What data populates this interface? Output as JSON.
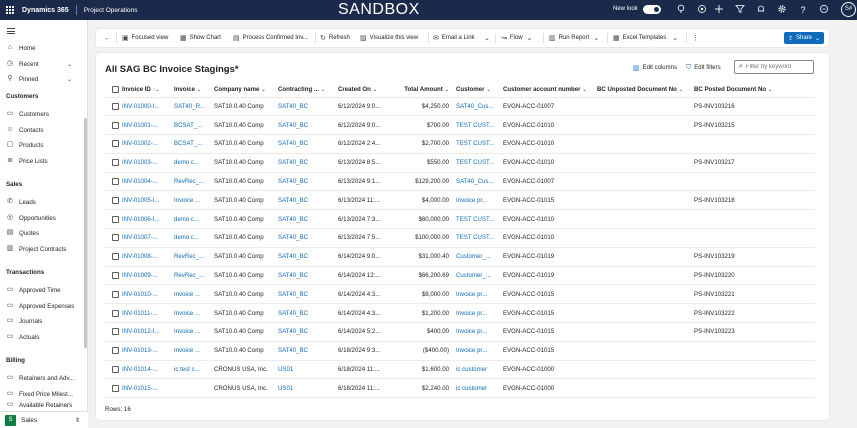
{
  "topbar": {
    "brand": "Dynamics 365",
    "app": "Project Operations",
    "environment": "SANDBOX",
    "new_look_label": "New look",
    "user_initials": "S#",
    "icons": [
      "lightbulb-icon",
      "target-icon",
      "plus-icon",
      "filter-icon",
      "bell-icon",
      "settings-icon",
      "help-icon",
      "copilot-icon"
    ]
  },
  "sidebar": {
    "top_items": [
      {
        "label": "Home",
        "icon": "home-icon"
      },
      {
        "label": "Recent",
        "icon": "clock-icon",
        "chevron": "⌄"
      },
      {
        "label": "Pinned",
        "icon": "pin-icon",
        "chevron": "⌄"
      }
    ],
    "groups": [
      {
        "title": "Customers",
        "items": [
          "Customers",
          "Contacts",
          "Products",
          "Price Lists"
        ]
      },
      {
        "title": "Sales",
        "items": [
          "Leads",
          "Opportunities",
          "Quotes",
          "Project Contracts"
        ]
      },
      {
        "title": "Transactions",
        "items": [
          "Approved Time",
          "Approved Expenses",
          "Journals",
          "Actuals"
        ]
      },
      {
        "title": "Billing",
        "items": [
          "Retainers and Adv...",
          "Fixed Price Milest...",
          "Available Retainers"
        ]
      }
    ],
    "area": {
      "badge": "S",
      "label": "Sales"
    }
  },
  "commands": {
    "focused_view": "Focused view",
    "show_chart": "Show Chart",
    "process_confirmed": "Process Confirmed Inv...",
    "refresh": "Refresh",
    "visualize": "Visualize this view",
    "email_link": "Email a Link",
    "flow": "Flow",
    "run_report": "Run Report",
    "excel_templates": "Excel Templates",
    "share": "Share"
  },
  "view": {
    "title": "All SAG BC Invoice Stagings*",
    "edit_columns": "Edit columns",
    "edit_filters": "Edit filters",
    "filter_placeholder": "Filter by keyword",
    "rows_label": "Rows: 16"
  },
  "columns": [
    "Invoice ID",
    "Invoice",
    "Company name",
    "Contracting ...",
    "Created On",
    "Total Amount",
    "Customer",
    "Customer account number",
    "BC Unposted Document No",
    "BC Posted Document No"
  ],
  "rows": [
    [
      "INV-01000-I...",
      "SAT40_R...",
      "SAT10.0.40 Comp",
      "SAT40_BC",
      "6/12/2024 9:0...",
      "$4,250.00",
      "SAT40_Cus...",
      "EVGN-ACC-01007",
      "",
      "PS-INV103216"
    ],
    [
      "INV-01001-...",
      "BCSAT_...",
      "SAT10.0.40 Comp",
      "SAT40_BC",
      "6/12/2024 9:0...",
      "$700.00",
      "TEST CUST...",
      "EVGN-ACC-01010",
      "",
      "PS-INV103215"
    ],
    [
      "INV-01002-...",
      "BCSAT_...",
      "SAT10.0.40 Comp",
      "SAT40_BC",
      "6/12/2024 2:4...",
      "$2,700.00",
      "TEST CUST...",
      "EVGN-ACC-01010",
      "",
      ""
    ],
    [
      "INV-01003-...",
      "demo c...",
      "SAT10.0.40 Comp",
      "SAT40_BC",
      "6/13/2024 8:5...",
      "$550.00",
      "TEST CUST...",
      "EVGN-ACC-01010",
      "",
      "PS-INV103217"
    ],
    [
      "INV-01004-...",
      "RevRec_...",
      "SAT10.0.40 Comp",
      "SAT40_BC",
      "6/13/2024 9:1...",
      "$129,200.00",
      "SAT40_Cus...",
      "EVGN-ACC-01007",
      "",
      ""
    ],
    [
      "INV-01005-I...",
      "Invoice ...",
      "SAT10.0.40 Comp",
      "SAT40_BC",
      "6/13/2024 11:...",
      "$4,000.00",
      "Invoice pr...",
      "EVGN-ACC-01015",
      "",
      "PS-INV103218"
    ],
    [
      "INV-01006-I...",
      "demo c...",
      "SAT10.0.40 Comp",
      "SAT40_BC",
      "6/13/2024 7:3...",
      "$60,000.00",
      "TEST CUST...",
      "EVGN-ACC-01010",
      "",
      ""
    ],
    [
      "INV-01007-...",
      "demo c...",
      "SAT10.0.40 Comp",
      "SAT40_BC",
      "6/13/2024 7:5...",
      "$100,000.00",
      "TEST CUST...",
      "EVGN-ACC-01010",
      "",
      ""
    ],
    [
      "INV-01008-...",
      "RevRec_...",
      "SAT10.0.40 Comp",
      "SAT40_BC",
      "6/14/2024 9:0...",
      "$31,000.40",
      "Customer_...",
      "EVGN-ACC-01019",
      "",
      "PS-INV103219"
    ],
    [
      "INV-01009-...",
      "RevRec_...",
      "SAT10.0.40 Comp",
      "SAT40_BC",
      "6/14/2024 12:...",
      "$66,200.69",
      "Customer_...",
      "EVGN-ACC-01019",
      "",
      "PS-INV103220"
    ],
    [
      "INV-01010-...",
      "Invoice ...",
      "SAT10.0.40 Comp",
      "SAT40_BC",
      "6/14/2024 4:3...",
      "$8,000.00",
      "Invoice pr...",
      "EVGN-ACC-01015",
      "",
      "PS-INV103221"
    ],
    [
      "INV-01011-...",
      "Invoice ...",
      "SAT10.0.40 Comp",
      "SAT40_BC",
      "6/14/2024 4:3...",
      "$1,200.00",
      "Invoice pr...",
      "EVGN-ACC-01015",
      "",
      "PS-INV103222"
    ],
    [
      "INV-01012-I...",
      "Invoice ...",
      "SAT10.0.40 Comp",
      "SAT40_BC",
      "6/14/2024 5:2...",
      "$400.00",
      "Invoice pr...",
      "EVGN-ACC-01015",
      "",
      "PS-INV103223"
    ],
    [
      "INV-01013-...",
      "Invoice ...",
      "SAT10.0.40 Comp",
      "SAT40_BC",
      "6/18/2024 9:3...",
      "($400.00)",
      "Invoice pr...",
      "EVGN-ACC-01015",
      "",
      ""
    ],
    [
      "INV-01014-...",
      "ic test c...",
      "CRONUS USA, Inc.",
      "US01",
      "6/18/2024 11:...",
      "$1,600.00",
      "ic customer",
      "EVGN-ACC-01000",
      "",
      ""
    ],
    [
      "INV-01015-...",
      "",
      "CRONUS USA, Inc.",
      "US01",
      "6/18/2024 11:...",
      "$2,240.00",
      "ic customer",
      "EVGN-ACC-01000",
      "",
      ""
    ]
  ]
}
